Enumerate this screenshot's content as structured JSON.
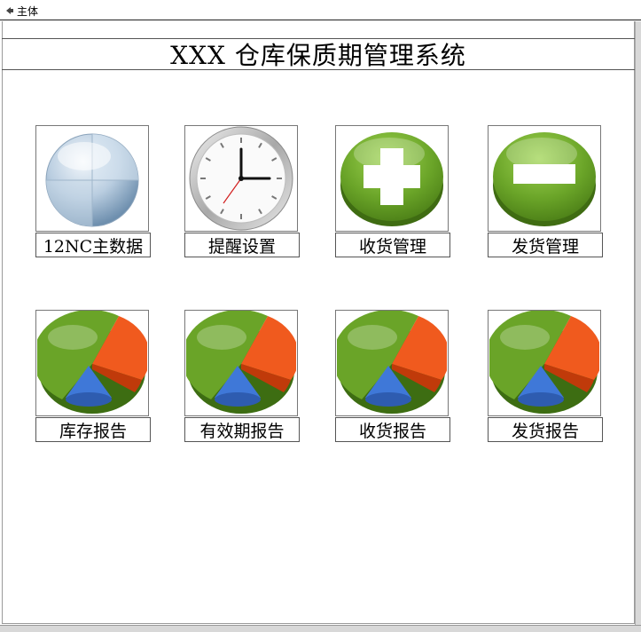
{
  "tab": {
    "label": "主体",
    "icon": "form-icon"
  },
  "header": {
    "title": "XXX 仓库保质期管理系统"
  },
  "tiles": [
    {
      "label": "12NC主数据",
      "icon": "globe-icon"
    },
    {
      "label": "提醒设置",
      "icon": "clock-icon"
    },
    {
      "label": "收货管理",
      "icon": "plus-icon"
    },
    {
      "label": "发货管理",
      "icon": "minus-icon"
    },
    {
      "label": "库存报告",
      "icon": "pie-chart-icon"
    },
    {
      "label": "有效期报告",
      "icon": "pie-chart-icon"
    },
    {
      "label": "收货报告",
      "icon": "pie-chart-icon"
    },
    {
      "label": "发货报告",
      "icon": "pie-chart-icon"
    }
  ],
  "colors": {
    "green": "#6aa428",
    "orange": "#f05a1e",
    "blue": "#3f78d8"
  }
}
